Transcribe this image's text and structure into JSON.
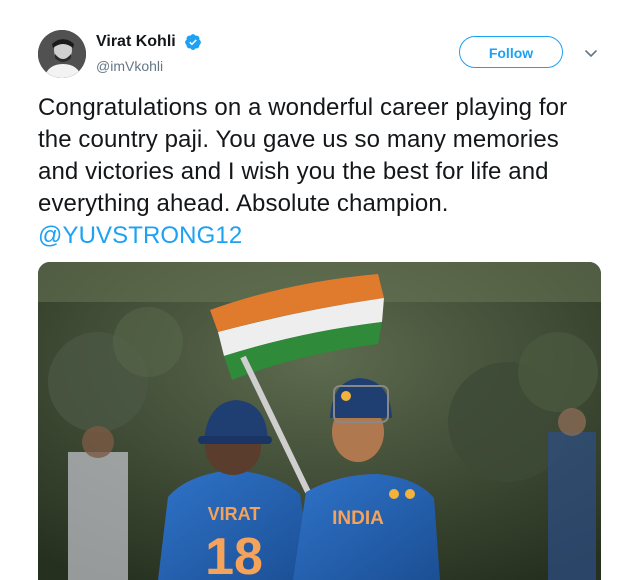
{
  "tweet": {
    "author": {
      "name": "Virat Kohli",
      "handle": "@imVkohli",
      "verified_icon": "verified-badge-icon"
    },
    "follow_label": "Follow",
    "menu_icon": "chevron-down-icon",
    "text_before": "Congratulations on a wonderful career playing for the country paji. You gave us so many memories and victories and I wish you the best for life and everything ahead. Absolute champion.",
    "mention": "@YUVSTRONG12",
    "photo": {
      "jersey_left": "VIRAT",
      "jersey_left_number": "18",
      "jersey_right": "INDIA"
    },
    "colors": {
      "accent": "#1da1f2",
      "text": "#14171a",
      "muted": "#657786"
    }
  }
}
